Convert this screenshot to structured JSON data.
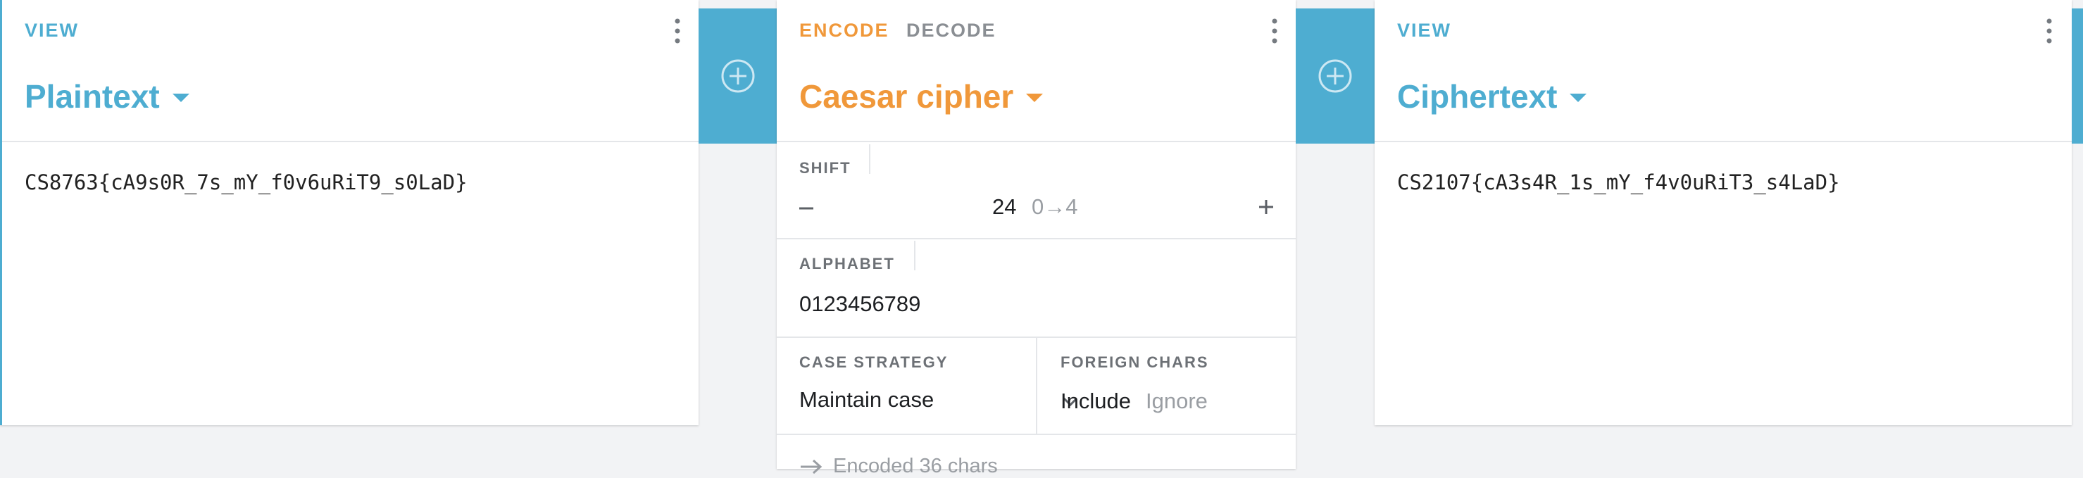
{
  "colors": {
    "view_blue": "#4eadd1",
    "op_orange": "#f0983a",
    "panel_bg": "#f2f3f5",
    "rail_blue": "#4eadd1"
  },
  "left_panel": {
    "mode_label": "VIEW",
    "title": "Plaintext",
    "content": "CS8763{cA9s0R_7s_mY_f0v6uRiT9_s0LaD}"
  },
  "middle_panel": {
    "tab_encode": "ENCODE",
    "tab_decode": "DECODE",
    "title": "Caesar cipher",
    "shift": {
      "label": "SHIFT",
      "value": "24",
      "mapping": "0→4",
      "minus": "−",
      "plus": "+"
    },
    "alphabet": {
      "label": "ALPHABET",
      "value": "0123456789"
    },
    "case_strategy": {
      "label": "CASE STRATEGY",
      "value": "Maintain case"
    },
    "foreign_chars": {
      "label": "FOREIGN CHARS",
      "include": "Include",
      "ignore": "Ignore"
    },
    "status": "Encoded 36 chars"
  },
  "right_panel": {
    "mode_label": "VIEW",
    "title": "Ciphertext",
    "content": "CS2107{cA3s4R_1s_mY_f4v0uRiT3_s4LaD}"
  },
  "icons": {
    "add": "plus-circle-icon",
    "menu": "kebab-menu-icon",
    "dropdown": "caret-down-icon",
    "chevron": "chevron-down-icon",
    "arrow": "arrow-right-icon"
  }
}
